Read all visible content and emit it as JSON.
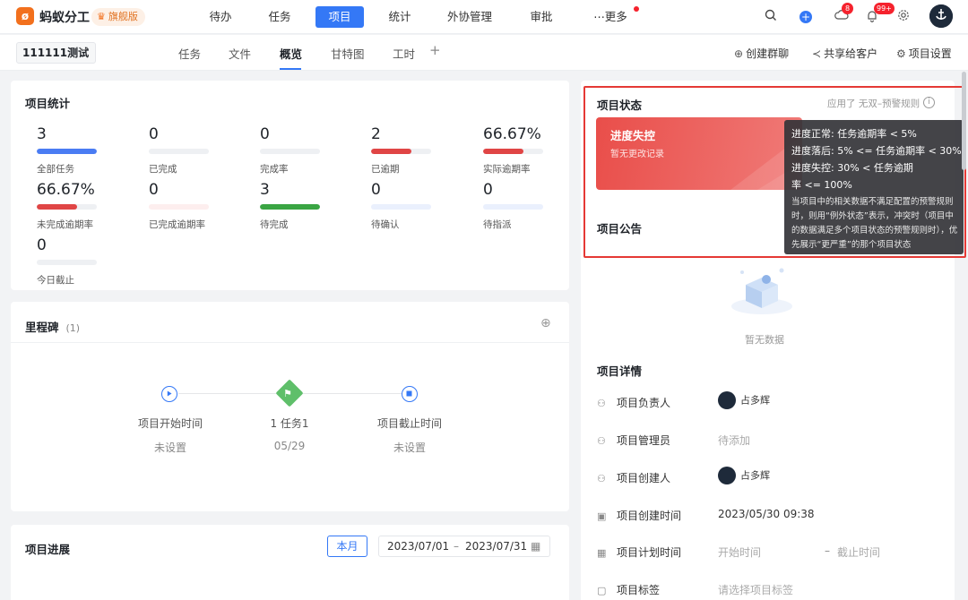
{
  "topbar": {
    "brand": "蚂蚁分工",
    "edition": "旗舰版",
    "nav": [
      "待办",
      "任务",
      "项目",
      "统计",
      "外协管理",
      "审批",
      "⋯更多"
    ],
    "active_nav": "项目",
    "notif_count_1": "8",
    "notif_count_2": "99+"
  },
  "subbar": {
    "project_name": "111111测试",
    "tabs": [
      "任务",
      "文件",
      "概览",
      "甘特图",
      "工时"
    ],
    "active_tab": "概览",
    "add_tab": "+",
    "actions": [
      "创建群聊",
      "共享给客户",
      "项目设置"
    ]
  },
  "stats_card": {
    "title": "项目统计",
    "stats": [
      {
        "value": "3",
        "label": "全部任务",
        "fill": 1.0,
        "color": "#4a7cf3"
      },
      {
        "value": "0",
        "label": "已完成",
        "fill": 0,
        "color": "#4a7cf3"
      },
      {
        "value": "0",
        "label": "完成率",
        "fill": 0,
        "color": "#4a7cf3"
      },
      {
        "value": "2",
        "label": "已逾期",
        "fill": 0.6667,
        "color": "#e04545"
      },
      {
        "value": "66.67%",
        "label": "实际逾期率",
        "fill": 0.6667,
        "color": "#e04545"
      },
      {
        "value": "66.67%",
        "label": "未完成逾期率",
        "fill": 0.6667,
        "color": "#e04545"
      },
      {
        "value": "0",
        "label": "已完成逾期率",
        "fill": 0,
        "color": "#e04545",
        "track": "#fdeeee"
      },
      {
        "value": "3",
        "label": "待完成",
        "fill": 1.0,
        "color": "#3aa543"
      },
      {
        "value": "0",
        "label": "待确认",
        "fill": 0,
        "color": "#4a7cf3",
        "track": "#eaf0fd"
      },
      {
        "value": "0",
        "label": "待指派",
        "fill": 0,
        "color": "#4a7cf3",
        "track": "#eaf0fd"
      },
      {
        "value": "0",
        "label": "今日截止",
        "fill": 0,
        "color": "#4a7cf3"
      }
    ]
  },
  "milestone_card": {
    "title": "里程碑",
    "count": "(1)",
    "nodes": [
      {
        "title": "项目开始时间",
        "sub": "未设置"
      },
      {
        "title": "1 任务1",
        "sub": "05/29"
      },
      {
        "title": "项目截止时间",
        "sub": "未设置"
      }
    ]
  },
  "progress_card": {
    "title": "项目进展",
    "month_btn": "本月",
    "date_start": "2023/07/01",
    "date_sep": "–",
    "date_end": "2023/07/31"
  },
  "status_section": {
    "title": "项目状态",
    "rule_prefix": "应用了",
    "rule_name": "无双–预警规则",
    "state": "进度失控",
    "state_sub": "暂无更改记录"
  },
  "tooltip": {
    "lines": [
      "进度正常: 任务逾期率 < 5%",
      "进度落后: 5% <= 任务逾期率 < 30%",
      "进度失控: 30% < 任务逾期",
      "率 <= 100%"
    ],
    "note": "当项目中的相关数据不满足配置的预警规则时，则用“例外状态”表示，冲突时（项目中的数据满足多个项目状态的预警规则时），优先展示“更严重”的那个项目状态"
  },
  "notice_section": {
    "title": "项目公告",
    "empty": "暂无数据"
  },
  "details": {
    "title": "项目详情",
    "rows": [
      {
        "label": "项目负责人",
        "value": "占多辉"
      },
      {
        "label": "项目管理员",
        "value": "待添加"
      },
      {
        "label": "项目创建人",
        "value": "占多辉"
      },
      {
        "label": "项目创建时间",
        "value": "2023/05/30 09:38"
      },
      {
        "label": "项目计划时间",
        "value": "开始时间",
        "value2": "截止时间",
        "sep": "–"
      },
      {
        "label": "项目标签",
        "value": "请选择项目标签"
      }
    ]
  }
}
